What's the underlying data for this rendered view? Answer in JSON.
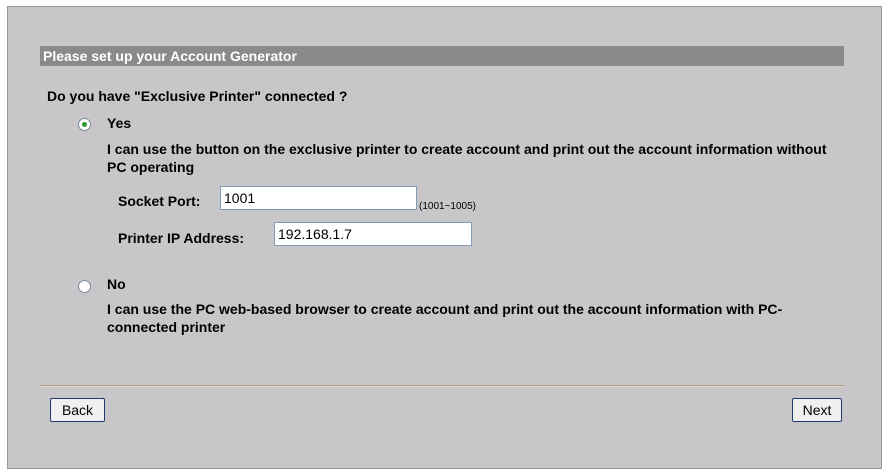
{
  "header": {
    "title": "Please set up your Account Generator"
  },
  "question": "Do you have \"Exclusive Printer\" connected ?",
  "options": {
    "yes": {
      "label": "Yes",
      "checked": true,
      "description": "I can use the button on the exclusive printer to create account and print out the account information without PC operating"
    },
    "no": {
      "label": "No",
      "checked": false,
      "description": "I can use the PC web-based browser to create account and print out the account information with PC-connected printer"
    }
  },
  "fields": {
    "socket_port": {
      "label": "Socket Port:",
      "value": "1001",
      "hint": "(1001~1005)"
    },
    "printer_ip": {
      "label": "Printer IP Address:",
      "value": "192.168.1.7"
    }
  },
  "buttons": {
    "back": "Back",
    "next": "Next"
  },
  "colors": {
    "panel_bg": "#c9c6c9",
    "title_bar_bg": "#8c898c",
    "radio_dot": "#2f9a2f"
  }
}
